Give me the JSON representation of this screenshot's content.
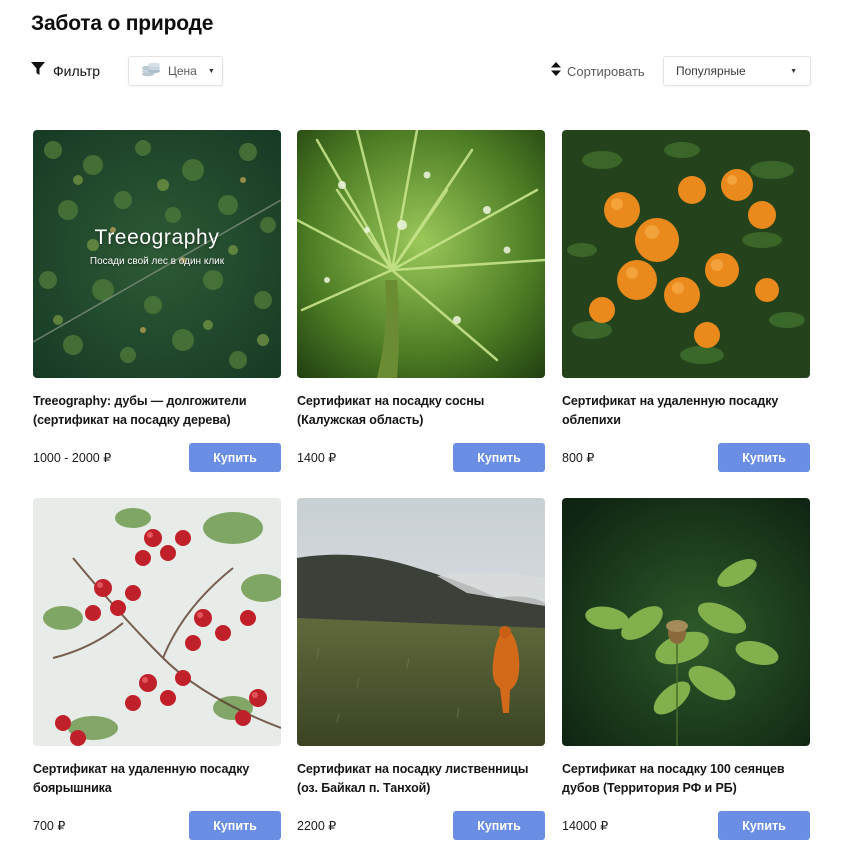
{
  "page": {
    "title": "Забота о природе"
  },
  "toolbar": {
    "filter_label": "Фильтр",
    "price_label": "Цена",
    "sort_label": "Сортировать",
    "sort_value": "Популярные"
  },
  "colors": {
    "accent": "#6a8ee4"
  },
  "products": [
    {
      "title": "Treeography: дубы — долгожители (сертификат на посадку дерева)",
      "price": "1000 - 2000 ₽",
      "buy_label": "Купить",
      "overlay_title": "Treeography",
      "overlay_subtitle": "Посади свой лес в один клик"
    },
    {
      "title": "Сертификат на посадку сосны (Калужская область)",
      "price": "1400 ₽",
      "buy_label": "Купить"
    },
    {
      "title": "Сертификат на удаленную посадку облепихи",
      "price": "800 ₽",
      "buy_label": "Купить"
    },
    {
      "title": "Сертификат на удаленную посадку боярышника",
      "price": "700 ₽",
      "buy_label": "Купить"
    },
    {
      "title": "Сертификат на посадку лиственницы (оз. Байкал п. Танхой)",
      "price": "2200 ₽",
      "buy_label": "Купить"
    },
    {
      "title": "Сертификат на посадку 100 сеянцев дубов (Территория РФ и РБ)",
      "price": "14000 ₽",
      "buy_label": "Купить"
    }
  ]
}
